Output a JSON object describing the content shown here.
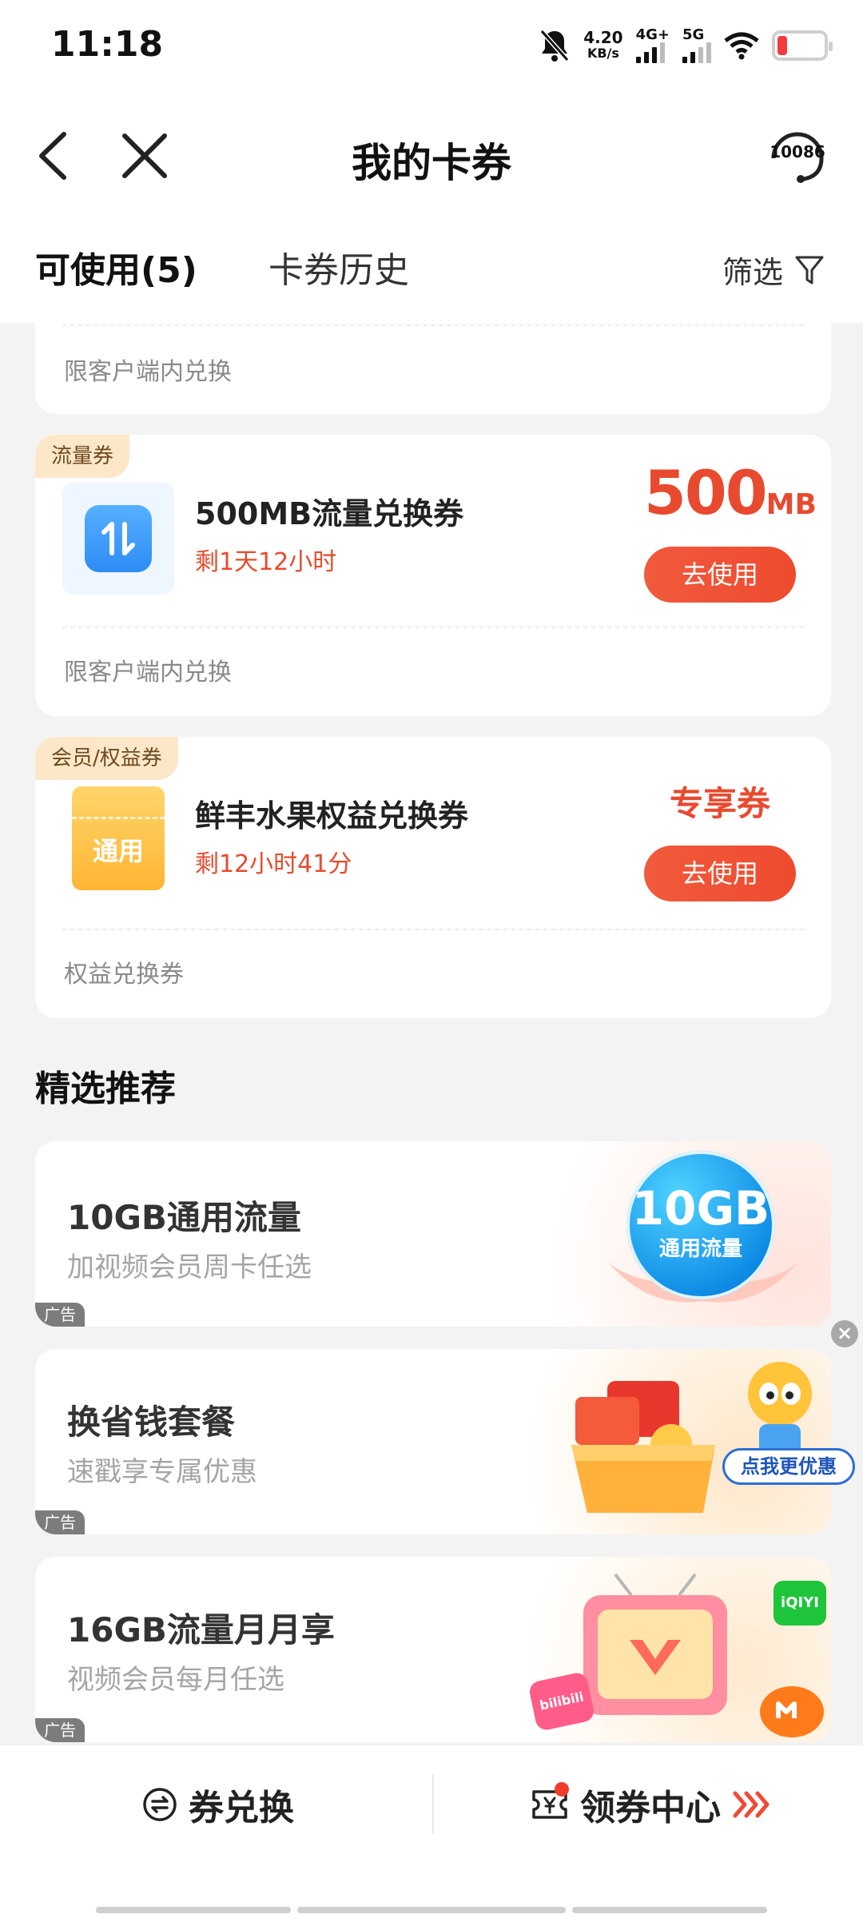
{
  "status_bar": {
    "time": "11:18",
    "speed_value": "4.20",
    "speed_unit": "KB/s",
    "net1": "4G+",
    "net2": "5G"
  },
  "nav": {
    "title": "我的卡券",
    "service_number": "10086"
  },
  "tabs": {
    "available": "可使用(5)",
    "history": "卡券历史",
    "filter": "筛选"
  },
  "cards": [
    {
      "footer": "限客户端内兑换"
    },
    {
      "tag": "流量券",
      "title": "500MB流量兑换券",
      "time_left": "剩1天12小时",
      "value_num": "500",
      "value_unit": "MB",
      "button": "去使用",
      "footer": "限客户端内兑换"
    },
    {
      "tag": "会员/权益券",
      "icon_text": "通用",
      "title": "鲜丰水果权益兑换券",
      "time_left": "剩12小时41分",
      "value_text": "专享券",
      "button": "去使用",
      "footer": "权益兑换券"
    }
  ],
  "recommend": {
    "title": "精选推荐",
    "items": [
      {
        "title": "10GB通用流量",
        "subtitle": "加视频会员周卡任选",
        "ad": "广告",
        "badge_big": "10GB",
        "badge_small": "通用流量"
      },
      {
        "title": "换省钱套餐",
        "subtitle": "速戳享专属优惠",
        "ad": "广告",
        "cta": "点我更优惠"
      },
      {
        "title": "16GB流量月月享",
        "subtitle": "视频会员每月任选",
        "ad": "广告",
        "logo1": "iQIYI",
        "logo2": "bilibili"
      }
    ]
  },
  "bottom": {
    "exchange": "券兑换",
    "center": "领券中心"
  },
  "colors": {
    "accent": "#ee4b2e",
    "tag_bg": "#fde7c9"
  }
}
